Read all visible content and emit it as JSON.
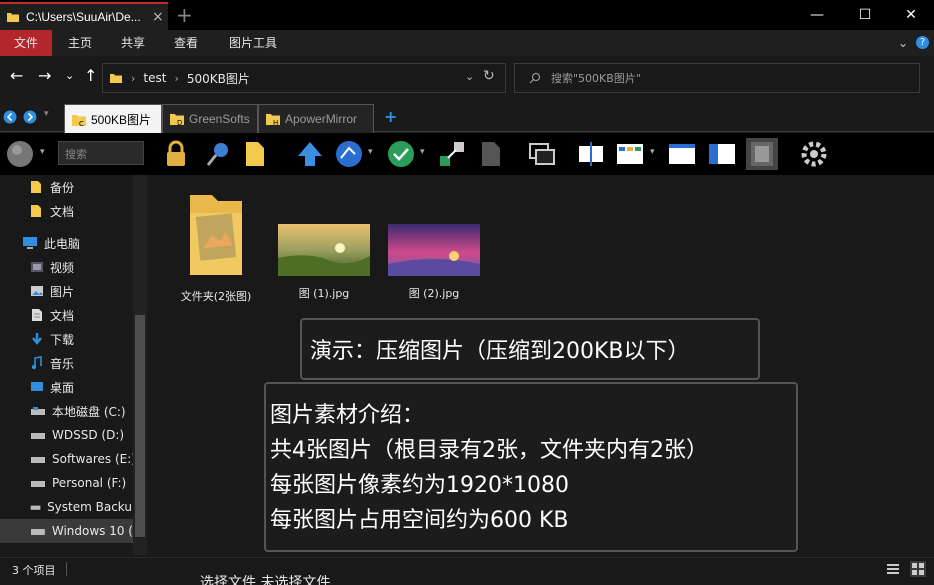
{
  "window": {
    "tab_title": "C:\\Users\\SuuAir\\De...",
    "close_tab": "×",
    "new_tab": "+",
    "minimize": "—",
    "maximize": "☐",
    "close": "✕"
  },
  "ribbon": {
    "file": "文件",
    "home": "主页",
    "share": "共享",
    "view": "查看",
    "picture_tools": "图片工具",
    "collapse": "⌄",
    "help": "?"
  },
  "address": {
    "back": "←",
    "forward": "→",
    "recent": "⌄",
    "up": "↑",
    "crumbs": [
      "test",
      "500KB图片"
    ],
    "refresh": "↻",
    "dropdown": "⌄",
    "search_placeholder": "搜索\"500KB图片\""
  },
  "folder_tabs": [
    {
      "label": "500KB图片",
      "badge": "C"
    },
    {
      "label": "GreenSofts",
      "badge": "D"
    },
    {
      "label": "ApowerMirror",
      "badge": "H"
    }
  ],
  "toolbar": {
    "search_placeholder": "搜索"
  },
  "sidebar": {
    "items": [
      {
        "label": "备份",
        "icon": "folder-icon"
      },
      {
        "label": "文档",
        "icon": "folder-icon"
      },
      {
        "label": "此电脑",
        "icon": "computer-icon"
      },
      {
        "label": "视频",
        "icon": "video-icon"
      },
      {
        "label": "图片",
        "icon": "picture-icon"
      },
      {
        "label": "文档",
        "icon": "document-icon"
      },
      {
        "label": "下载",
        "icon": "download-icon"
      },
      {
        "label": "音乐",
        "icon": "music-icon"
      },
      {
        "label": "桌面",
        "icon": "desktop-icon"
      },
      {
        "label": "本地磁盘 (C:)",
        "icon": "drive-icon"
      },
      {
        "label": "WDSSD (D:)",
        "icon": "drive-icon"
      },
      {
        "label": "Softwares (E:)",
        "icon": "drive-icon"
      },
      {
        "label": "Personal (F:)",
        "icon": "drive-icon"
      },
      {
        "label": "System Backu",
        "icon": "drive-icon"
      },
      {
        "label": "Windows 10 (",
        "icon": "drive-icon"
      }
    ]
  },
  "files": [
    {
      "name": "文件夹(2张图)",
      "type": "folder"
    },
    {
      "name": "图 (1).jpg",
      "type": "image"
    },
    {
      "name": "图 (2).jpg",
      "type": "image"
    }
  ],
  "overlay": {
    "caption1": "演示：压缩图片（压缩到200KB以下）",
    "caption2_lines": [
      "图片素材介绍：",
      "共4张图片（根目录有2张，文件夹内有2张）",
      "每张图片像素约为1920*1080",
      "每张图片占用空间约为600 KB"
    ]
  },
  "status": {
    "count": "3 个项目",
    "overflow_text": "选择文件  未选择文件"
  },
  "colors": {
    "accent_red": "#b3262c",
    "folder_yellow": "#f2c94c",
    "blue_icon": "#2f8ee0"
  }
}
